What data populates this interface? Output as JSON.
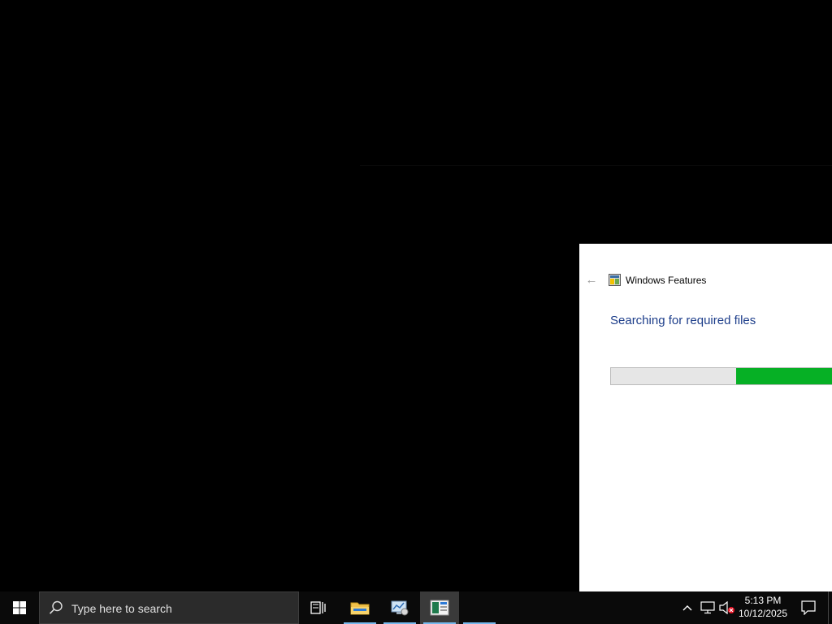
{
  "dialog": {
    "title": "Windows Features",
    "back_icon": "back-arrow-icon",
    "app_icon": "windows-features-icon",
    "status_heading": "Searching for required files",
    "progress": {
      "start_fraction": 0.567,
      "end_fraction": 1.0,
      "fill_color": "#06b025",
      "track_color": "#e6e6e6"
    }
  },
  "taskbar": {
    "start_icon": "windows-logo-icon",
    "search": {
      "placeholder": "Type here to search",
      "icon": "search-icon"
    },
    "pinned": [
      {
        "name": "task-view",
        "icon": "task-view-icon",
        "running": false
      },
      {
        "name": "file-explorer",
        "icon": "folder-icon",
        "running": true
      },
      {
        "name": "control-panel",
        "icon": "control-panel-icon",
        "running": true
      },
      {
        "name": "windows-features",
        "icon": "windows-features-icon",
        "running": true,
        "active": true
      }
    ],
    "tray": {
      "overflow_icon": "chevron-up-icon",
      "network_icon": "network-icon",
      "volume_icon": "volume-muted-icon",
      "time": "5:13 PM",
      "date": "10/12/2025",
      "notification_icon": "action-center-icon"
    },
    "accent_color": "#76b9ed"
  }
}
